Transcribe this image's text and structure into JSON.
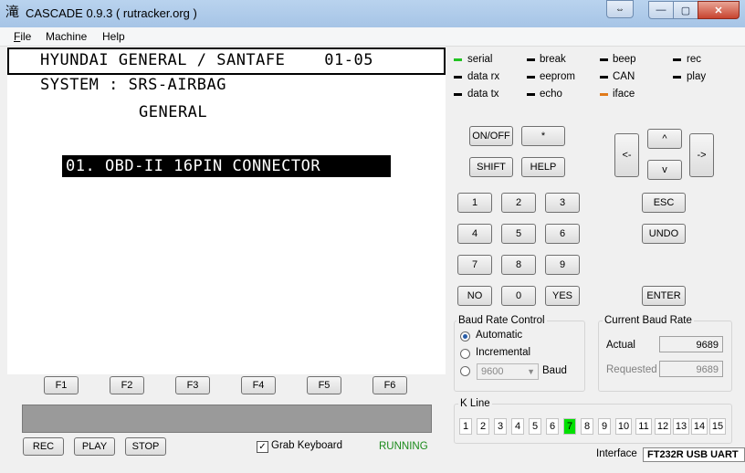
{
  "window": {
    "title": "CASCADE 0.9.3 ( rutracker.org )",
    "app_icon": "滝",
    "min": "—",
    "max": "▢",
    "close": "✕",
    "restore": "⇔"
  },
  "menu": [
    "File",
    "Machine",
    "Help"
  ],
  "screen": {
    "header": "HYUNDAI GENERAL / SANTAFE    01-05",
    "line2": "SYSTEM : SRS-AIRBAG",
    "line3": "GENERAL",
    "selected": "01. OBD-II 16PIN CONNECTOR"
  },
  "function_keys": [
    "F1",
    "F2",
    "F3",
    "F4",
    "F5",
    "F6"
  ],
  "bottom_buttons": {
    "rec": "REC",
    "play": "PLAY",
    "stop": "STOP"
  },
  "grab_keyboard": {
    "label": "Grab Keyboard",
    "checked": "✓"
  },
  "status": "RUNNING",
  "indicators": [
    {
      "label": "serial",
      "color": "#22c322"
    },
    {
      "label": "break",
      "color": "#000000"
    },
    {
      "label": "beep",
      "color": "#000000"
    },
    {
      "label": "rec",
      "color": "#000000"
    },
    {
      "label": "data rx",
      "color": "#000000"
    },
    {
      "label": "eeprom",
      "color": "#000000"
    },
    {
      "label": "CAN",
      "color": "#000000"
    },
    {
      "label": "play",
      "color": "#000000"
    },
    {
      "label": "data tx",
      "color": "#000000"
    },
    {
      "label": "echo",
      "color": "#000000"
    },
    {
      "label": "iface",
      "color": "#e07a1a"
    }
  ],
  "keypad": {
    "onoff": "ON/OFF",
    "star": "*",
    "shift": "SHIFT",
    "help": "HELP",
    "left": "<-",
    "up": "^",
    "right": "->",
    "down": "v",
    "n1": "1",
    "n2": "2",
    "n3": "3",
    "n4": "4",
    "n5": "5",
    "n6": "6",
    "n7": "7",
    "n8": "8",
    "n9": "9",
    "no": "NO",
    "n0": "0",
    "yes": "YES",
    "esc": "ESC",
    "undo": "UNDO",
    "enter": "ENTER"
  },
  "baud_control": {
    "title": "Baud Rate Control",
    "automatic": "Automatic",
    "incremental": "Incremental",
    "select_value": "9600",
    "select_arrow": "▼",
    "baud_label": "Baud"
  },
  "current_baud": {
    "title": "Current Baud Rate",
    "actual_label": "Actual",
    "actual_value": "9689",
    "requested_label": "Requested",
    "requested_value": "9689"
  },
  "kline": {
    "title": "K Line",
    "cells": [
      "1",
      "2",
      "3",
      "4",
      "5",
      "6",
      "7",
      "8",
      "9",
      "10",
      "11",
      "12",
      "13",
      "14",
      "15"
    ],
    "active": "7"
  },
  "interface": {
    "label": "Interface",
    "value": "FT232R USB UART"
  }
}
